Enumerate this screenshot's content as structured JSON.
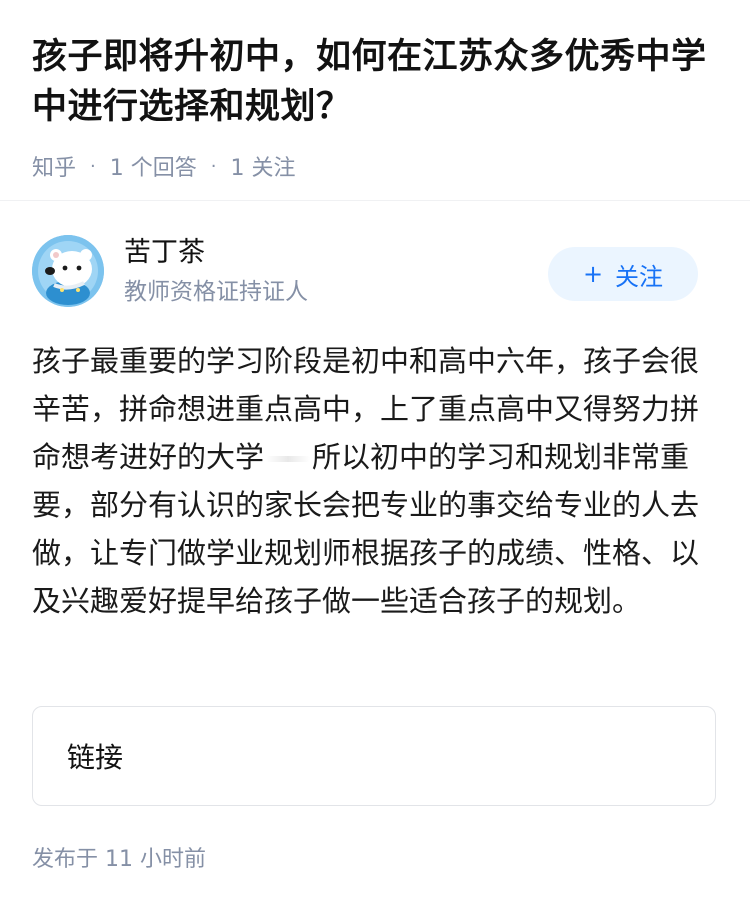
{
  "question": {
    "title": "孩子即将升初中，如何在江苏众多优秀中学中进行选择和规划？",
    "source": "知乎",
    "answers_count": "1 个回答",
    "followers_count": "1 关注"
  },
  "author": {
    "name": "苦丁茶",
    "badge": "教师资格证持证人",
    "avatar_icon": "polar-bear-avatar-icon",
    "follow_label": "关注",
    "follow_icon": "plus-icon"
  },
  "answer": {
    "text_part1": "孩子最重要的学习阶段是初中和高中六年，孩子会很辛苦，拼命想进重点高中，上了重点高中又得努力拼命想考进好的大学",
    "text_part2": "所以初中的学习和规划非常重要，部分有认识的家长会把专业的事交给专业的人去做，让专门做学业规划师根据孩子的成绩、性格、以及兴趣爱好提早给孩子做一些适合孩子的规划。",
    "link_label": "链接",
    "published": "发布于 11 小时前"
  },
  "colors": {
    "accent": "#1772f6",
    "follow_bg": "#ebf5ff",
    "muted": "#8590a6",
    "text": "#121212"
  }
}
